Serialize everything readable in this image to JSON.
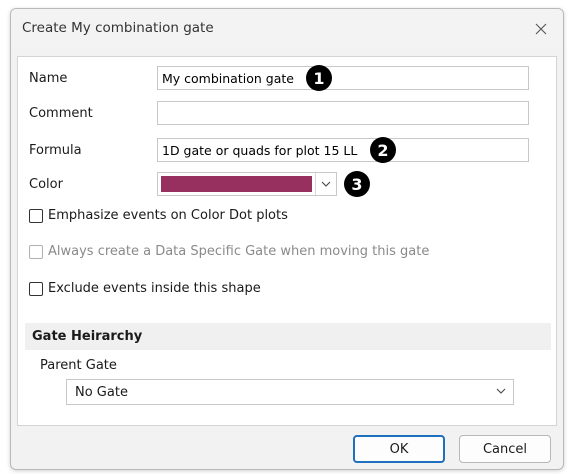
{
  "window": {
    "title": "Create My combination gate"
  },
  "form": {
    "name_label": "Name",
    "name_value": "My combination gate",
    "comment_label": "Comment",
    "comment_value": "",
    "formula_label": "Formula",
    "formula_value": "1D gate or quads for plot 15 LL",
    "color_label": "Color",
    "color_value": "#97305e"
  },
  "markers": {
    "m1": "1",
    "m2": "2",
    "m3": "3"
  },
  "options": {
    "emphasize": "Emphasize events on Color Dot plots",
    "always_create": "Always create a Data Specific Gate when moving this gate",
    "exclude": "Exclude events inside this shape"
  },
  "hierarchy": {
    "header": "Gate Heirarchy",
    "parent_label": "Parent Gate",
    "parent_value": "No Gate"
  },
  "buttons": {
    "ok": "OK",
    "cancel": "Cancel"
  },
  "icons": {
    "close": "close-icon",
    "chevron": "chevron-down-icon"
  }
}
